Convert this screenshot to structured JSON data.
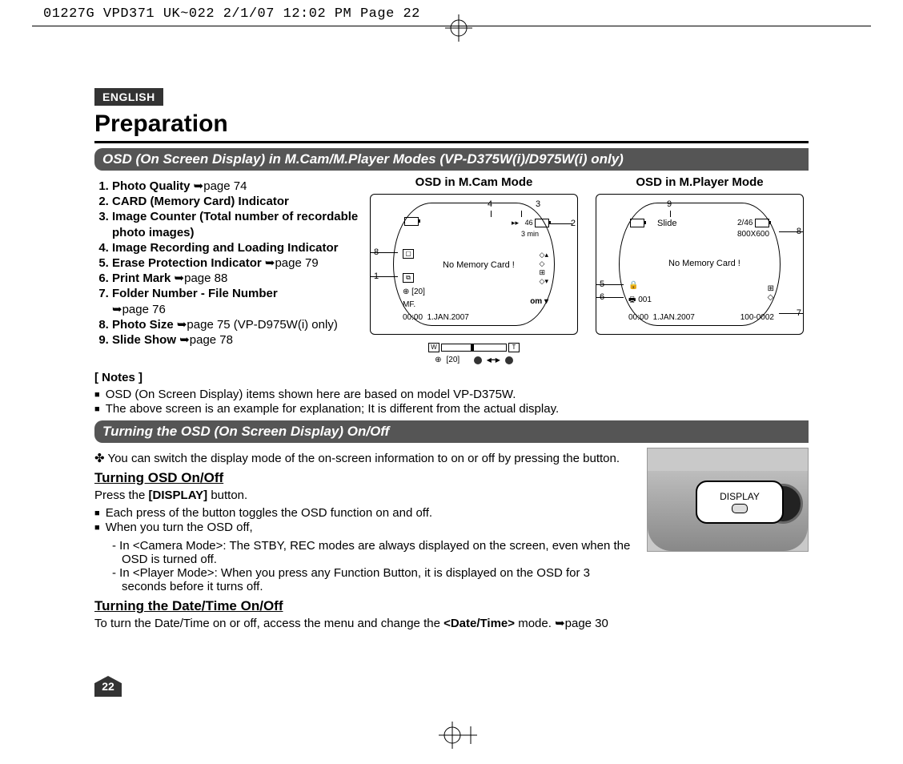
{
  "crop_header": "01227G VPD371 UK~022  2/1/07 12:02 PM  Page 22",
  "language_badge": "ENGLISH",
  "page_title": "Preparation",
  "section1_title": "OSD (On Screen Display) in M.Cam/M.Player Modes (VP-D375W(i)/D975W(i) only)",
  "osd_items": [
    {
      "label": "Photo Quality",
      "ref": "➥page 74"
    },
    {
      "label": "CARD (Memory Card) Indicator",
      "ref": ""
    },
    {
      "label": "Image Counter (Total number of recordable photo images)",
      "ref": ""
    },
    {
      "label": "Image Recording and Loading Indicator",
      "ref": ""
    },
    {
      "label": "Erase Protection Indicator",
      "ref": "➥page 79"
    },
    {
      "label": "Print Mark",
      "ref": "➥page 88"
    },
    {
      "label": "Folder Number - File Number",
      "ref": "➥page 76"
    },
    {
      "label": "Photo Size",
      "ref": "➥page 75 (VP-D975W(i) only)"
    },
    {
      "label": "Slide Show",
      "ref": "➥page 78"
    }
  ],
  "panel_mcam": {
    "title": "OSD in M.Cam Mode",
    "count": "46",
    "remain": "3 min",
    "msg": "No Memory Card !",
    "bracket": "[20]",
    "mf": "MF.",
    "time": "00:00",
    "date": "1.JAN.2007",
    "zoom_w": "W",
    "zoom_t": "T",
    "bracket2": "[20]",
    "c1": "1",
    "c2": "2",
    "c3": "3",
    "c4": "4",
    "c8": "8"
  },
  "panel_mplayer": {
    "title": "OSD in M.Player Mode",
    "slide": "Slide",
    "count": "2/46",
    "size": "800X600",
    "msg": "No Memory Card !",
    "print": "001",
    "time": "00:00",
    "date": "1.JAN.2007",
    "folder": "100-0002",
    "c5": "5",
    "c6": "6",
    "c7": "7",
    "c8": "8",
    "c9": "9"
  },
  "notes_title": "[ Notes ]",
  "notes": [
    "OSD (On Screen Display) items shown here are based on model VP-D375W.",
    "The above screen is an example for explanation; It is different from the actual display."
  ],
  "section2_title": "Turning the OSD (On Screen Display) On/Off",
  "tick_para_pre": "✤ You can switch the display mode of the on-screen information to on or off by pressing the button.",
  "sub_onoff": "Turning OSD On/Off",
  "press_line_pre": "Press the ",
  "press_line_b": "[DISPLAY]",
  "press_line_post": " button.",
  "onoff_bullets": [
    "Each press of the button toggles the OSD function on and off.",
    "When you turn the OSD off,"
  ],
  "dash_items": [
    {
      "pre": "- In ",
      "b": "<Camera Mode>",
      "post": ": The STBY, REC modes are always displayed on the screen, even when the OSD is turned off."
    },
    {
      "pre": "- In ",
      "b": "<Player Mode>",
      "post": ": When you press any Function Button, it is displayed on the OSD for 3 seconds before it turns off."
    }
  ],
  "sub_datetime": "Turning the Date/Time On/Off",
  "datetime_pre": "To turn the Date/Time on or off, access the menu and change the ",
  "datetime_b": "<Date/Time>",
  "datetime_post": " mode. ➥page 30",
  "display_label": "DISPLAY",
  "page_number": "22"
}
